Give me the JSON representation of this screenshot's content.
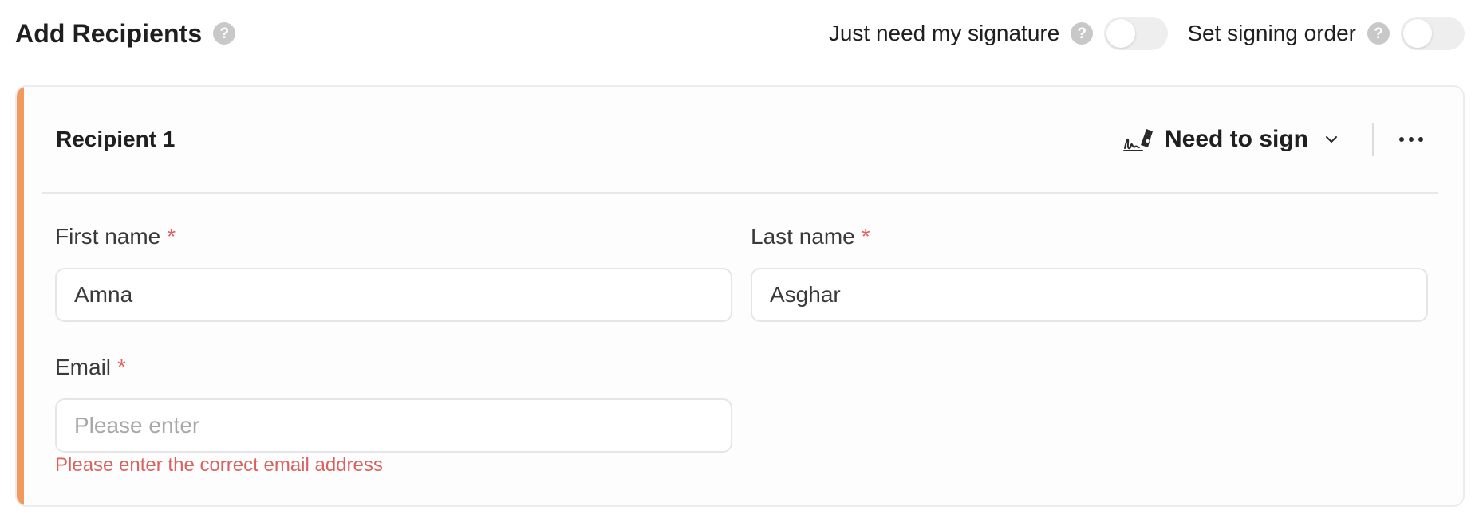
{
  "header": {
    "title": "Add Recipients",
    "title_help_icon": "?",
    "toggles": [
      {
        "label": "Just need my signature",
        "help_icon": "?",
        "enabled": false
      },
      {
        "label": "Set signing order",
        "help_icon": "?",
        "enabled": false
      }
    ]
  },
  "recipient": {
    "title": "Recipient 1",
    "accent_color": "#f2995f",
    "role": {
      "icon": "signature-pen-icon",
      "label": "Need to sign"
    },
    "more_icon": "more-horizontal-icon",
    "fields": {
      "first_name": {
        "label": "First name",
        "required_mark": "*",
        "value": "Amna"
      },
      "last_name": {
        "label": "Last name",
        "required_mark": "*",
        "value": "Asghar"
      },
      "email": {
        "label": "Email",
        "required_mark": "*",
        "value": "",
        "placeholder": "Please enter",
        "error": "Please enter the correct email address"
      }
    }
  },
  "colors": {
    "error": "#d9625d",
    "required": "#e06060",
    "accent": "#f2995f"
  }
}
